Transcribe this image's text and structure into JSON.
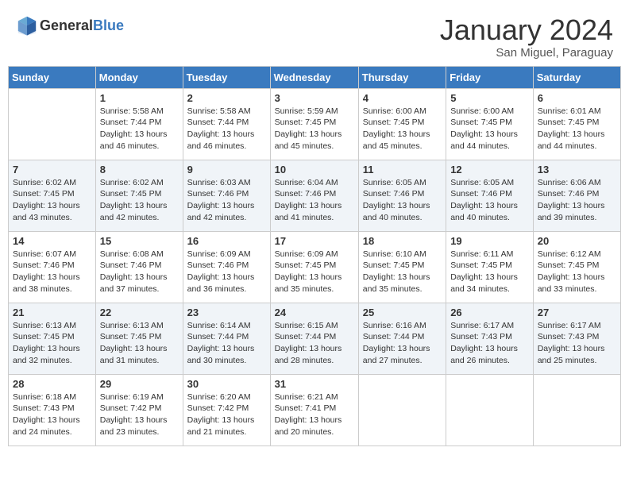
{
  "header": {
    "logo": {
      "general": "General",
      "blue": "Blue"
    },
    "month": "January 2024",
    "location": "San Miguel, Paraguay"
  },
  "weekdays": [
    "Sunday",
    "Monday",
    "Tuesday",
    "Wednesday",
    "Thursday",
    "Friday",
    "Saturday"
  ],
  "weeks": [
    [
      {
        "day": "",
        "info": ""
      },
      {
        "day": "1",
        "info": "Sunrise: 5:58 AM\nSunset: 7:44 PM\nDaylight: 13 hours and 46 minutes."
      },
      {
        "day": "2",
        "info": "Sunrise: 5:58 AM\nSunset: 7:44 PM\nDaylight: 13 hours and 46 minutes."
      },
      {
        "day": "3",
        "info": "Sunrise: 5:59 AM\nSunset: 7:45 PM\nDaylight: 13 hours and 45 minutes."
      },
      {
        "day": "4",
        "info": "Sunrise: 6:00 AM\nSunset: 7:45 PM\nDaylight: 13 hours and 45 minutes."
      },
      {
        "day": "5",
        "info": "Sunrise: 6:00 AM\nSunset: 7:45 PM\nDaylight: 13 hours and 44 minutes."
      },
      {
        "day": "6",
        "info": "Sunrise: 6:01 AM\nSunset: 7:45 PM\nDaylight: 13 hours and 44 minutes."
      }
    ],
    [
      {
        "day": "7",
        "info": "Sunrise: 6:02 AM\nSunset: 7:45 PM\nDaylight: 13 hours and 43 minutes."
      },
      {
        "day": "8",
        "info": "Sunrise: 6:02 AM\nSunset: 7:45 PM\nDaylight: 13 hours and 42 minutes."
      },
      {
        "day": "9",
        "info": "Sunrise: 6:03 AM\nSunset: 7:46 PM\nDaylight: 13 hours and 42 minutes."
      },
      {
        "day": "10",
        "info": "Sunrise: 6:04 AM\nSunset: 7:46 PM\nDaylight: 13 hours and 41 minutes."
      },
      {
        "day": "11",
        "info": "Sunrise: 6:05 AM\nSunset: 7:46 PM\nDaylight: 13 hours and 40 minutes."
      },
      {
        "day": "12",
        "info": "Sunrise: 6:05 AM\nSunset: 7:46 PM\nDaylight: 13 hours and 40 minutes."
      },
      {
        "day": "13",
        "info": "Sunrise: 6:06 AM\nSunset: 7:46 PM\nDaylight: 13 hours and 39 minutes."
      }
    ],
    [
      {
        "day": "14",
        "info": "Sunrise: 6:07 AM\nSunset: 7:46 PM\nDaylight: 13 hours and 38 minutes."
      },
      {
        "day": "15",
        "info": "Sunrise: 6:08 AM\nSunset: 7:46 PM\nDaylight: 13 hours and 37 minutes."
      },
      {
        "day": "16",
        "info": "Sunrise: 6:09 AM\nSunset: 7:46 PM\nDaylight: 13 hours and 36 minutes."
      },
      {
        "day": "17",
        "info": "Sunrise: 6:09 AM\nSunset: 7:45 PM\nDaylight: 13 hours and 35 minutes."
      },
      {
        "day": "18",
        "info": "Sunrise: 6:10 AM\nSunset: 7:45 PM\nDaylight: 13 hours and 35 minutes."
      },
      {
        "day": "19",
        "info": "Sunrise: 6:11 AM\nSunset: 7:45 PM\nDaylight: 13 hours and 34 minutes."
      },
      {
        "day": "20",
        "info": "Sunrise: 6:12 AM\nSunset: 7:45 PM\nDaylight: 13 hours and 33 minutes."
      }
    ],
    [
      {
        "day": "21",
        "info": "Sunrise: 6:13 AM\nSunset: 7:45 PM\nDaylight: 13 hours and 32 minutes."
      },
      {
        "day": "22",
        "info": "Sunrise: 6:13 AM\nSunset: 7:45 PM\nDaylight: 13 hours and 31 minutes."
      },
      {
        "day": "23",
        "info": "Sunrise: 6:14 AM\nSunset: 7:44 PM\nDaylight: 13 hours and 30 minutes."
      },
      {
        "day": "24",
        "info": "Sunrise: 6:15 AM\nSunset: 7:44 PM\nDaylight: 13 hours and 28 minutes."
      },
      {
        "day": "25",
        "info": "Sunrise: 6:16 AM\nSunset: 7:44 PM\nDaylight: 13 hours and 27 minutes."
      },
      {
        "day": "26",
        "info": "Sunrise: 6:17 AM\nSunset: 7:43 PM\nDaylight: 13 hours and 26 minutes."
      },
      {
        "day": "27",
        "info": "Sunrise: 6:17 AM\nSunset: 7:43 PM\nDaylight: 13 hours and 25 minutes."
      }
    ],
    [
      {
        "day": "28",
        "info": "Sunrise: 6:18 AM\nSunset: 7:43 PM\nDaylight: 13 hours and 24 minutes."
      },
      {
        "day": "29",
        "info": "Sunrise: 6:19 AM\nSunset: 7:42 PM\nDaylight: 13 hours and 23 minutes."
      },
      {
        "day": "30",
        "info": "Sunrise: 6:20 AM\nSunset: 7:42 PM\nDaylight: 13 hours and 21 minutes."
      },
      {
        "day": "31",
        "info": "Sunrise: 6:21 AM\nSunset: 7:41 PM\nDaylight: 13 hours and 20 minutes."
      },
      {
        "day": "",
        "info": ""
      },
      {
        "day": "",
        "info": ""
      },
      {
        "day": "",
        "info": ""
      }
    ]
  ]
}
